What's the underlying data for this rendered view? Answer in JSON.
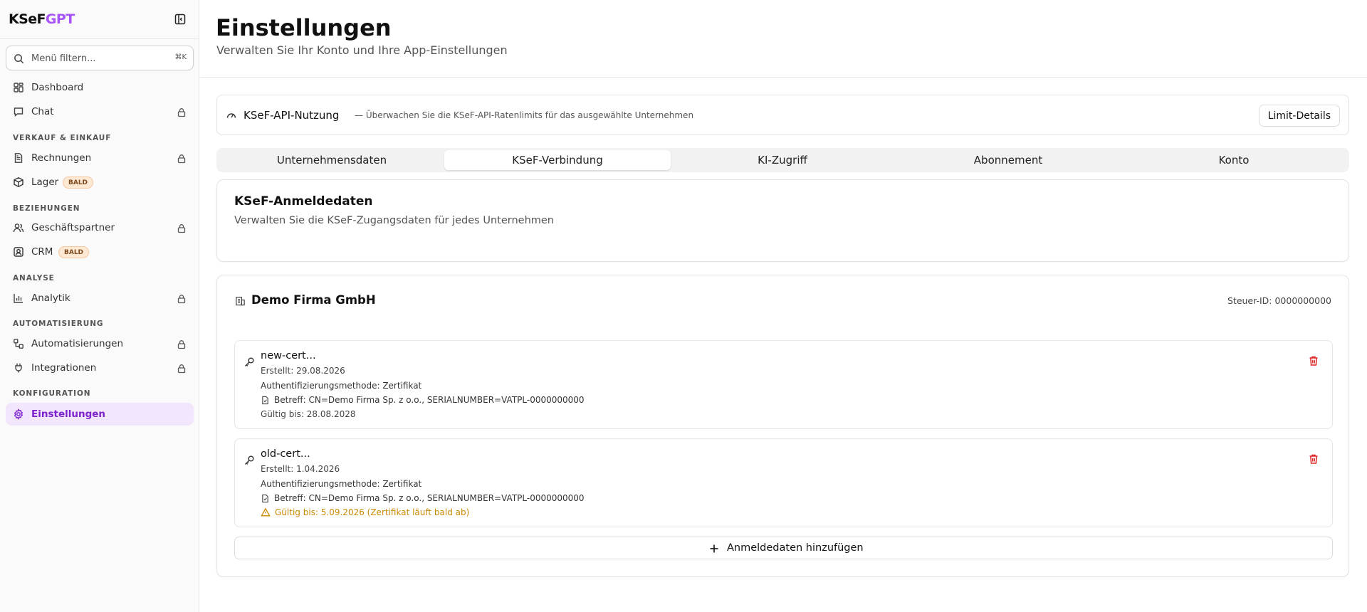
{
  "app": {
    "logo_main": "KSeF",
    "logo_accent": "GPT",
    "accent_color": "#a855f7"
  },
  "sidebar": {
    "search_placeholder": "Menü filtern...",
    "search_shortcut": "⌘K",
    "items": [
      {
        "label": "Dashboard",
        "icon": "dashboard-icon"
      },
      {
        "label": "Chat",
        "icon": "chat-icon",
        "locked": true
      },
      {
        "label": "Rechnungen",
        "icon": "invoice-icon",
        "locked": true
      },
      {
        "label": "Lager",
        "icon": "box-icon",
        "badge": "BALD"
      },
      {
        "label": "Geschäftspartner",
        "icon": "users-icon",
        "locked": true
      },
      {
        "label": "CRM",
        "icon": "contact-icon",
        "badge": "BALD"
      },
      {
        "label": "Analytik",
        "icon": "chart-icon",
        "locked": true
      },
      {
        "label": "Automatisierungen",
        "icon": "workflow-icon",
        "locked": true
      },
      {
        "label": "Integrationen",
        "icon": "plug-icon",
        "locked": true
      },
      {
        "label": "Einstellungen",
        "icon": "gear-icon",
        "active": true
      }
    ],
    "sections": [
      "VERKAUF & EINKAUF",
      "BEZIEHUNGEN",
      "ANALYSE",
      "AUTOMATISIERUNG",
      "KONFIGURATION"
    ]
  },
  "header": {
    "title": "Einstellungen",
    "subtitle": "Verwalten Sie Ihr Konto und Ihre App-Einstellungen"
  },
  "usage": {
    "title": "KSeF-API-Nutzung",
    "description": "— Überwachen Sie die KSeF-API-Ratenlimits für das ausgewählte Unternehmen",
    "button": "Limit-Details"
  },
  "tabs": [
    {
      "label": "Unternehmensdaten"
    },
    {
      "label": "KSeF-Verbindung",
      "active": true
    },
    {
      "label": "KI-Zugriff"
    },
    {
      "label": "Abonnement"
    },
    {
      "label": "Konto"
    }
  ],
  "credentials_card": {
    "title": "KSeF-Anmeldedaten",
    "subtitle": "Verwalten Sie die KSeF-Zugangsdaten für jedes Unternehmen"
  },
  "company": {
    "name": "Demo Firma GmbH",
    "tax_id": "Steuer-ID: 0000000000"
  },
  "credentials": [
    {
      "name": "new-cert...",
      "created": "Erstellt: 29.08.2026",
      "method": "Authentifizierungsmethode:  Zertifikat",
      "subject": "Betreff: CN=Demo Firma Sp. z o.o., SERIALNUMBER=VATPL-0000000000",
      "valid": "Gültig bis: 28.08.2028",
      "warning": false
    },
    {
      "name": "old-cert...",
      "created": "Erstellt: 1.04.2026",
      "method": "Authentifizierungsmethode:  Zertifikat",
      "subject": "Betreff: CN=Demo Firma Sp. z o.o., SERIALNUMBER=VATPL-0000000000",
      "valid": "Gültig bis: 5.09.2026 (Zertifikat läuft bald ab)",
      "warning": true
    }
  ],
  "add_button": "Anmeldedaten hinzufügen",
  "colors": {
    "danger": "#dc2626",
    "warning": "#ca8a04",
    "active_bg": "#f1e6fb",
    "active_text": "#7e22ce"
  }
}
